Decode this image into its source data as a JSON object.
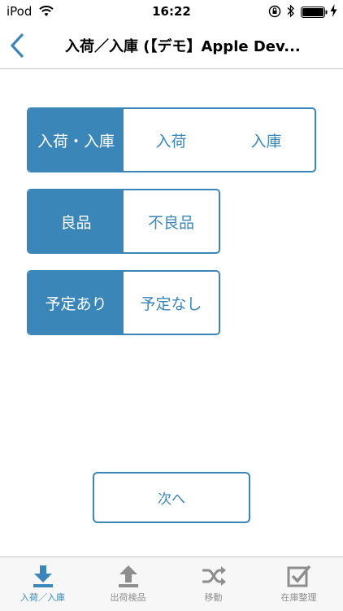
{
  "status_bar": {
    "carrier": "iPod",
    "time": "16:22"
  },
  "nav": {
    "title": "入荷／入庫 (【デモ】Apple Dev..."
  },
  "type_selector": {
    "options": [
      "入荷・入庫",
      "入荷",
      "入庫"
    ],
    "selected": "入荷・入庫"
  },
  "quality_selector": {
    "options": [
      "良品",
      "不良品"
    ],
    "selected": "良品"
  },
  "schedule_selector": {
    "options": [
      "予定あり",
      "予定なし"
    ],
    "selected": "予定あり"
  },
  "next_button": "次へ",
  "tabs": [
    {
      "label": "入荷／入庫",
      "icon": "download-icon",
      "active": true
    },
    {
      "label": "出荷検品",
      "icon": "upload-icon",
      "active": false
    },
    {
      "label": "移動",
      "icon": "shuffle-icon",
      "active": false
    },
    {
      "label": "在庫整理",
      "icon": "checkbox-icon",
      "active": false
    }
  ],
  "colors": {
    "accent": "#3b86b8",
    "tab_inactive": "#8e8e8e"
  }
}
